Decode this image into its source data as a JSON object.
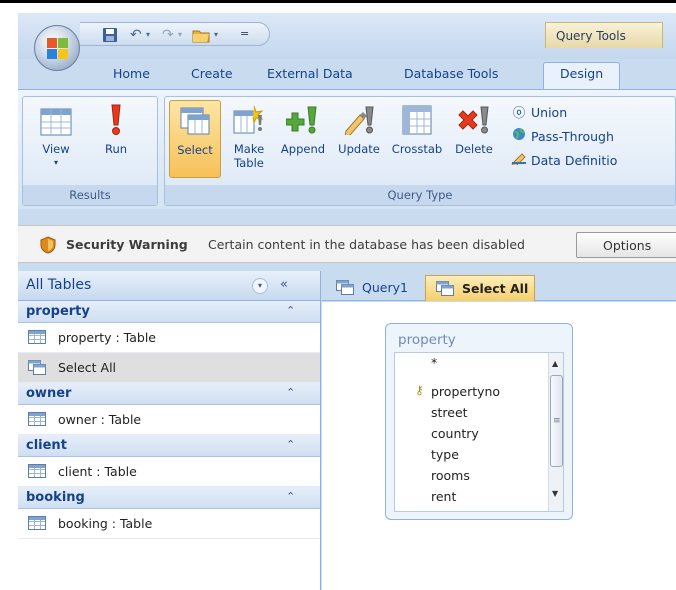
{
  "quick_access": {
    "undo": "↶",
    "redo": "↷",
    "open": "📂",
    "customize": "▾"
  },
  "contextual_tab": "Query Tools",
  "tabs": [
    "Home",
    "Create",
    "External Data",
    "Database Tools",
    "Design"
  ],
  "ribbon": {
    "results": {
      "label": "Results",
      "view": "View",
      "run": "Run"
    },
    "query_type": {
      "label": "Query Type",
      "select": "Select",
      "make_table_1": "Make",
      "make_table_2": "Table",
      "append": "Append",
      "update": "Update",
      "crosstab": "Crosstab",
      "delete": "Delete",
      "union": "Union",
      "pass_through": "Pass-Through",
      "data_definition": "Data Definitio"
    }
  },
  "security": {
    "title": "Security Warning",
    "message": "Certain content in the database has been disabled",
    "options": "Options"
  },
  "nav": {
    "title": "All Tables",
    "groups": [
      {
        "name": "property",
        "items": [
          {
            "label": "property : Table",
            "type": "table"
          },
          {
            "label": "Select All",
            "type": "query",
            "selected": true
          }
        ]
      },
      {
        "name": "owner",
        "items": [
          {
            "label": "owner : Table",
            "type": "table"
          }
        ]
      },
      {
        "name": "client",
        "items": [
          {
            "label": "client : Table",
            "type": "table"
          }
        ]
      },
      {
        "name": "booking",
        "items": [
          {
            "label": "booking : Table",
            "type": "table"
          }
        ]
      }
    ]
  },
  "doc_tabs": [
    "Query1",
    "Select All"
  ],
  "field_list": {
    "title": "property",
    "fields": [
      "*",
      "propertyno",
      "street",
      "country",
      "type",
      "rooms",
      "rent"
    ],
    "primary_key": "propertyno"
  }
}
